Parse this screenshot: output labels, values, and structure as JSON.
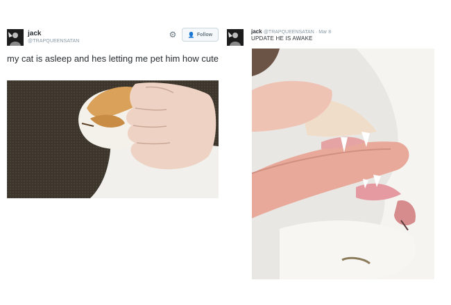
{
  "left_tweet": {
    "name": "jack",
    "handle": "@TRAPQUEENSATAN",
    "text": "my cat is asleep and hes letting me pet him how cute",
    "follow_label": "Follow",
    "icons": {
      "settings": "gear-icon",
      "follow": "add-user-icon"
    }
  },
  "right_tweet": {
    "name": "jack",
    "handle": "@TRAPQUEENSATAN",
    "date": "Mar 8",
    "text": "UPDATE HE IS AWAKE"
  },
  "colors": {
    "text": "#292f33",
    "muted": "#8899a6",
    "accent": "#55acee",
    "button_border": "#ccd6dd"
  }
}
